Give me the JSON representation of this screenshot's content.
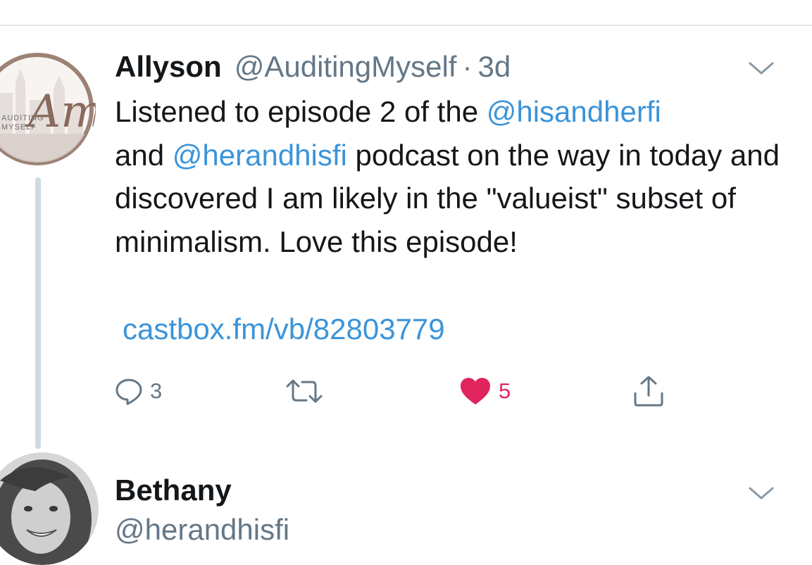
{
  "tweet": {
    "author_name": "Allyson",
    "author_handle": "@AuditingMyself",
    "separator": "·",
    "time": "3d",
    "avatar_text": {
      "monogram": "Am",
      "line1": "AUDITING",
      "line2": "MYSELF"
    },
    "body": {
      "part1": "Listened to episode 2 of the ",
      "mention1": "@hisandherfi",
      "part2": " and ",
      "mention2": "@herandhisfi",
      "part3": " podcast on the way in today and discovered I am likely in the \"valueist\" subset of minimalism. Love this episode!"
    },
    "link": "castbox.fm/vb/82803779",
    "actions": {
      "reply_count": "3",
      "like_count": "5"
    }
  },
  "reply": {
    "author_name": "Bethany",
    "author_handle": "@herandhisfi"
  },
  "colors": {
    "text": "#14171a",
    "secondary": "#657786",
    "link": "#3b94d9",
    "like": "#e0245e",
    "thread_line": "#cfd9de",
    "avatar_ring": "#9c8275"
  },
  "icons": {
    "reply": "reply-icon",
    "retweet": "retweet-icon",
    "like": "heart-icon",
    "share": "share-icon",
    "menu": "chevron-down-icon"
  }
}
